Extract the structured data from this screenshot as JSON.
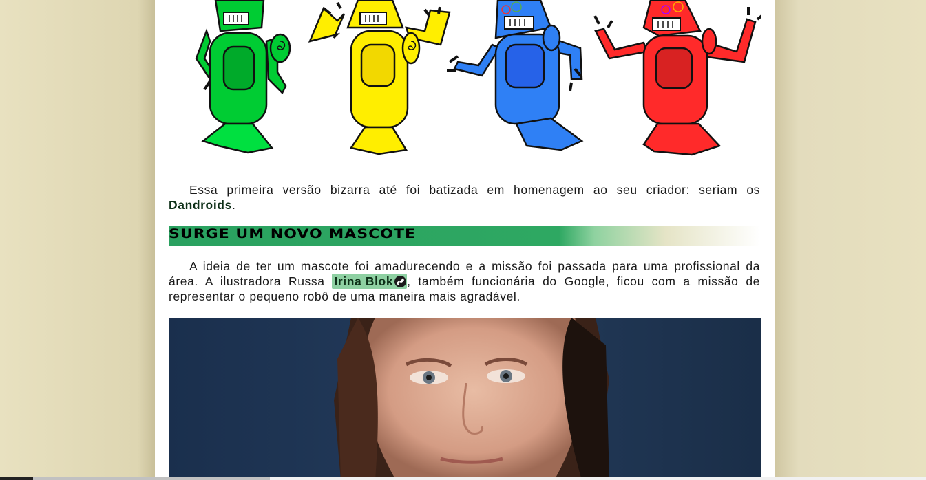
{
  "article": {
    "paragraph1": {
      "text": "Essa primeira versão bizarra até foi batizada em homenagem ao seu criador: seriam os ",
      "bold": "Dandroids",
      "end": "."
    },
    "section_heading": "SURGE UM NOVO MASCOTE",
    "paragraph2": {
      "text_before": "A ideia de ter um mascote foi amadurecendo e a missão foi passada para uma profissional da área. A ilustradora Russa ",
      "link_text": "Irina Blok",
      "text_after": ", também funcionária do Google, ficou com a missão de representar o pequeno robô de uma maneira mais agradável."
    }
  },
  "images": {
    "robots": {
      "icon": "dandroid-robots-illustration",
      "colors": [
        "#00c832",
        "#ffee00",
        "#2a7df5",
        "#ff2a2a"
      ]
    },
    "portrait": {
      "icon": "portrait-photo"
    }
  },
  "icons": {
    "link": "link-icon"
  },
  "colors": {
    "background": "#e8e1c0",
    "page": "#ffffff",
    "heading_bar": "#2ea862",
    "link_highlight": "#8ed0a2"
  }
}
